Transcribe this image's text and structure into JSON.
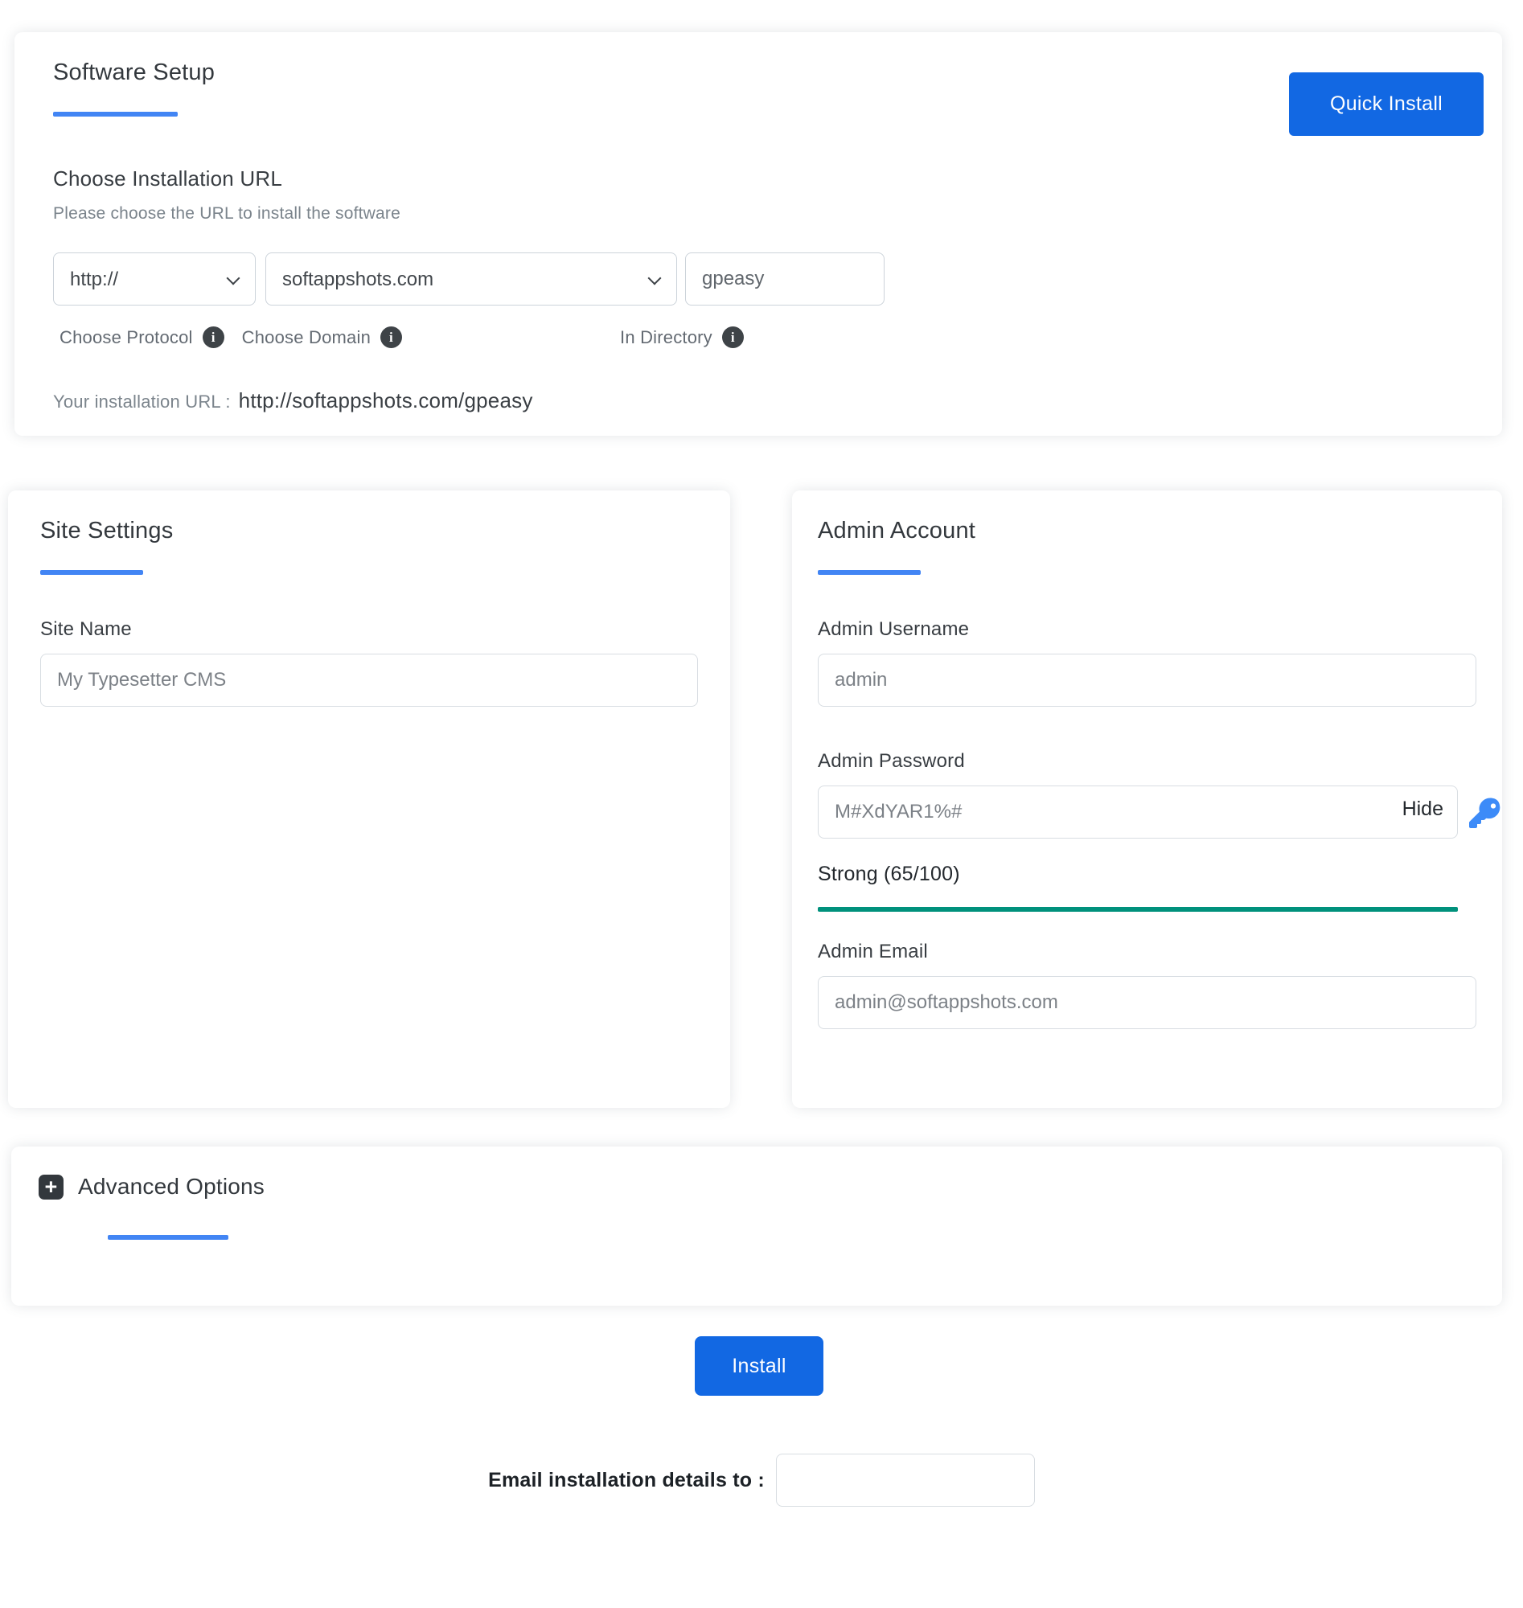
{
  "software_setup": {
    "title": "Software Setup",
    "quick_install_label": "Quick Install",
    "section_title": "Choose Installation URL",
    "section_subtitle": "Please choose the URL to install the software",
    "protocol": {
      "label": "Choose Protocol",
      "value": "http://"
    },
    "domain": {
      "label": "Choose Domain",
      "value": "softappshots.com"
    },
    "directory": {
      "label": "In Directory",
      "value": "gpeasy"
    },
    "installation_url_label": "Your installation URL :",
    "installation_url_value": "http://softappshots.com/gpeasy"
  },
  "site_settings": {
    "title": "Site Settings",
    "site_name_label": "Site Name",
    "site_name_value": "My Typesetter CMS"
  },
  "admin_account": {
    "title": "Admin Account",
    "username_label": "Admin Username",
    "username_value": "admin",
    "password_label": "Admin Password",
    "password_value": "M#XdYAR1%#",
    "hide_label": "Hide",
    "strength_text": "Strong (65/100)",
    "strength_score": "65",
    "strength_max": "100",
    "email_label": "Admin Email",
    "email_value": "admin@softappshots.com"
  },
  "advanced_options": {
    "title": "Advanced Options"
  },
  "footer": {
    "install_label": "Install",
    "email_details_label": "Email installation details to :",
    "email_details_value": ""
  },
  "icons": {
    "info": "i",
    "plus": "+"
  },
  "colors": {
    "accent_blue": "#1268e3",
    "underline_blue": "#4285f4",
    "strength_teal": "#00917c"
  }
}
